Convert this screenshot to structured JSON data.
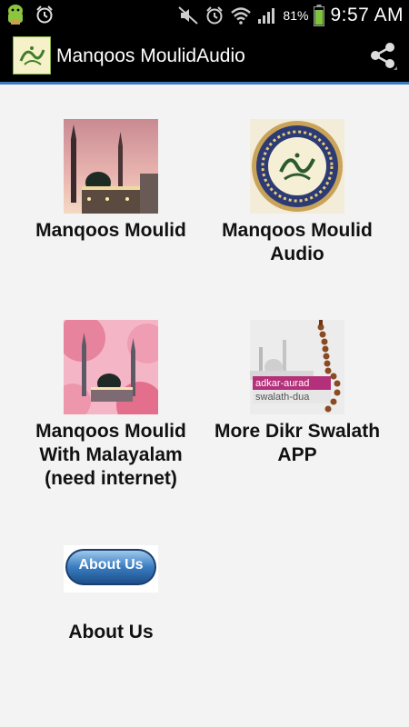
{
  "status_bar": {
    "battery_percent": "81%",
    "time": "9:57 AM"
  },
  "action_bar": {
    "title": "Manqoos MoulidAudio",
    "share_icon": "share-icon"
  },
  "tiles": [
    {
      "label": "Manqoos Moulid",
      "icon": "mosque-sunset-image"
    },
    {
      "label": "Manqoos Moulid Audio",
      "icon": "calligraphy-medallion-image"
    },
    {
      "label": "Manqoos Moulid With Malayalam (need internet)",
      "icon": "mosque-rose-image"
    },
    {
      "label": "More Dikr Swalath APP",
      "icon": "prayer-beads-image",
      "badge_line1": "adkar-aurad",
      "badge_line2": "swalath-dua"
    },
    {
      "label": "About Us",
      "icon": "about-us-button-image",
      "button_text": "About Us"
    }
  ],
  "colors": {
    "accent": "#3a7bbf",
    "background": "#f3f3f3"
  }
}
